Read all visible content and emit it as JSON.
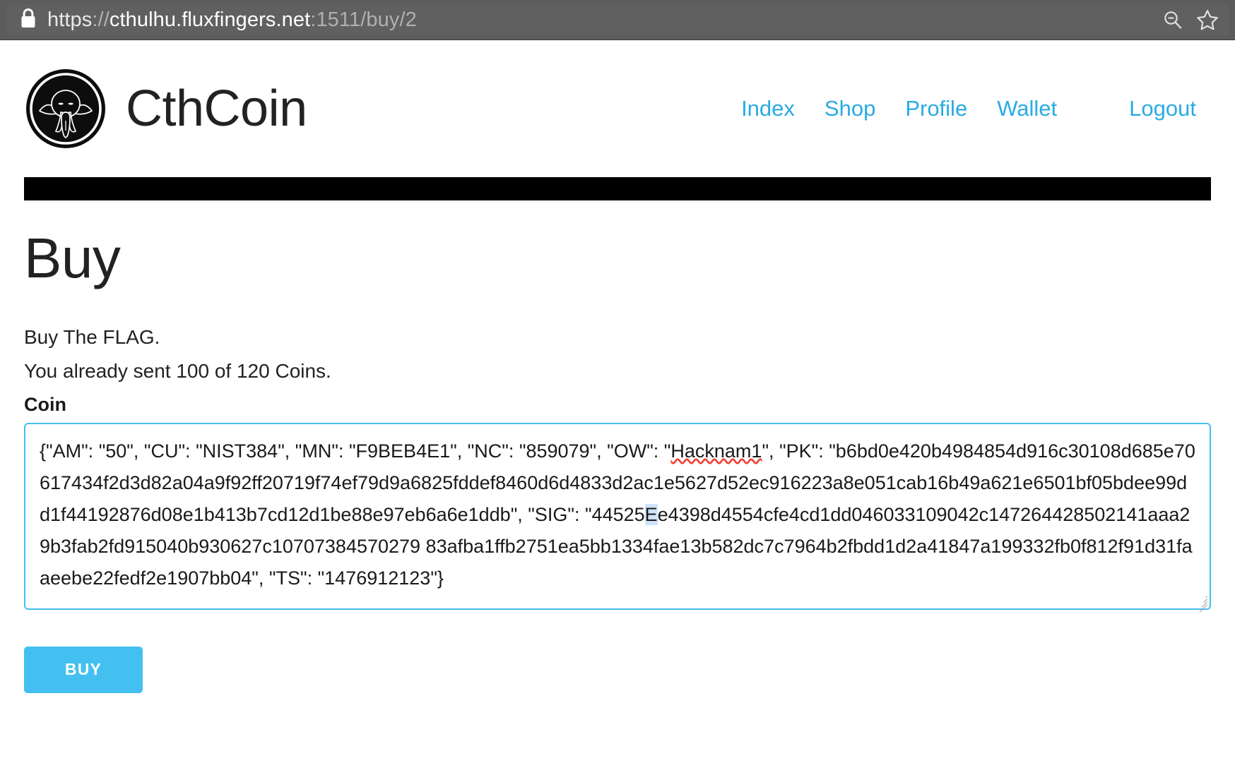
{
  "browser": {
    "lock_icon": "lock-icon",
    "url": {
      "scheme": "https",
      "separator": "://",
      "host": "cthulhu.fluxfingers.net",
      "tail": ":1511/buy/2",
      "full": "https://cthulhu.fluxfingers.net:1511/buy/2"
    },
    "actions": [
      {
        "name": "zoom-out-icon",
        "label": "Zoom out"
      },
      {
        "name": "bookmark-star-icon",
        "label": "Bookmark this page"
      }
    ]
  },
  "site": {
    "logo_name": "cthcoin-logo",
    "brand": "CthCoin",
    "nav": [
      {
        "label": "Index",
        "name": "nav-index"
      },
      {
        "label": "Shop",
        "name": "nav-shop"
      },
      {
        "label": "Profile",
        "name": "nav-profile"
      },
      {
        "label": "Wallet",
        "name": "nav-wallet"
      },
      {
        "label": "Logout",
        "name": "nav-logout"
      }
    ]
  },
  "main": {
    "title": "Buy",
    "description": "Buy The FLAG.",
    "status": "You already sent 100 of 120 Coins.",
    "field_label": "Coin",
    "coin": {
      "prefix": "{\"AM\": \"50\", \"CU\": \"NIST384\", \"MN\": \"F9BEB4E1\", \"NC\": \"859079\", \"OW\": \"",
      "owner_misspelled": "Hacknam1",
      "after_owner": "\", \"PK\": \"b6bd0e420b4984854d916c30108d685e70617434f2d3d82a04a9f92ff20719f74ef79d9a6825fddef8460d6d4833d2ac1e5627d52ec916223a8e051cab16b49a621e6501bf05bdee99dd1f44192876d08e1b413b7cd12d1be88e97eb6a6e1ddb\", \"SIG\": \"44525",
      "selected_char": "E",
      "after_selection": "e4398d4554cfe4cd1dd046033109042c147264428502141aaa29b3fab2fd915040b930627c10707384570279 83afba1ffb2751ea5bb1334fae13b582dc7c7964b2fbdd1d2a41847a199332fb0f812f91d31faaeebe22fedf2e1907bb04\", \"TS\": \"1476912123\"}",
      "fields": {
        "AM": "50",
        "CU": "NIST384",
        "MN": "F9BEB4E1",
        "NC": "859079",
        "OW": "Hacknam1",
        "PK": "b6bd0e420b4984854d916c30108d685e70617434f2d3d82a04a9f92ff20719f74ef79d9a6825fddef8460d6d4833d2ac1e5627d52ec916223a8e051cab16b49a621e6501bf05bdee99dd1f44192876d08e1b413b7cd12d1be88e97eb6a6e1ddb",
        "SIG": "44525Ee4398d4554cfe4cd1dd046033109042c147264428502141aaa29b3fab2fd915040b930627c1070738457027983afba1ffb2751ea5bb1334fae13b582dc7c7964b2fbdd1d2a41847a199332fb0f812f91d31faaeebe22fedf2e1907bb04",
        "TS": "1476912123"
      }
    },
    "submit_label": "BUY"
  },
  "colors": {
    "accent": "#44c0f0",
    "link": "#29abe2",
    "chrome": "#5c5c5c",
    "rule": "#000000",
    "spellcheck": "#ef4136",
    "selection": "#cfe4fb"
  }
}
